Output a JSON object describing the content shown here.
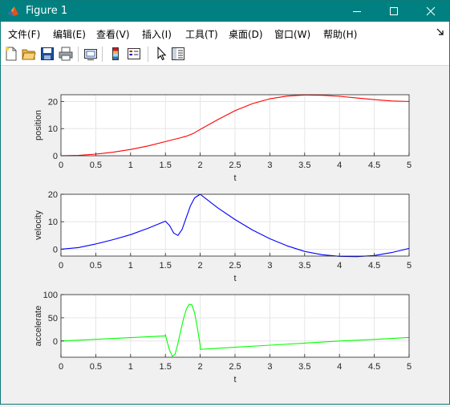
{
  "window": {
    "title": "Figure 1",
    "title_icon": "matlab-icon",
    "controls": [
      "minimize-icon",
      "maximize-icon",
      "close-icon"
    ]
  },
  "menu": {
    "items": [
      "文件(F)",
      "编辑(E)",
      "查看(V)",
      "插入(I)",
      "工具(T)",
      "桌面(D)",
      "窗口(W)",
      "帮助(H)"
    ],
    "dock_icon": "dock-arrow-icon"
  },
  "toolbar": {
    "buttons": [
      "new-figure-icon",
      "open-file-icon",
      "save-icon",
      "print-icon",
      "link-plot-icon",
      "insert-colorbar-icon",
      "insert-legend-icon",
      "edit-plot-icon",
      "open-property-inspector-icon"
    ]
  },
  "chart_data": [
    {
      "type": "line",
      "xlabel": "t",
      "ylabel": "position",
      "xlim": [
        0,
        5
      ],
      "ylim": [
        0,
        22.5
      ],
      "xticks": [
        "0",
        "0.5",
        "1",
        "1.5",
        "2",
        "2.5",
        "3",
        "3.5",
        "4",
        "4.5",
        "5"
      ],
      "yticks": [
        "0",
        "10",
        "20"
      ],
      "grid": true,
      "series": [
        {
          "color": "#ff0000",
          "x": [
            0,
            0.25,
            0.5,
            0.75,
            1,
            1.25,
            1.5,
            1.6,
            1.7,
            1.8,
            1.9,
            2,
            2.25,
            2.5,
            2.75,
            3,
            3.25,
            3.5,
            3.75,
            4,
            4.25,
            4.5,
            4.75,
            5
          ],
          "y": [
            0,
            0.15,
            0.6,
            1.3,
            2.3,
            3.6,
            5.2,
            5.9,
            6.5,
            7.2,
            8.2,
            9.7,
            13.3,
            16.6,
            19.2,
            21.0,
            22.0,
            22.4,
            22.3,
            21.9,
            21.3,
            20.7,
            20.2,
            20.0
          ]
        }
      ]
    },
    {
      "type": "line",
      "xlabel": "t",
      "ylabel": "velocity",
      "xlim": [
        0,
        5
      ],
      "ylim": [
        -2.5,
        20
      ],
      "xticks": [
        "0",
        "0.5",
        "1",
        "1.5",
        "2",
        "2.5",
        "3",
        "3.5",
        "4",
        "4.5",
        "5"
      ],
      "yticks": [
        "0",
        "10",
        "20"
      ],
      "grid": true,
      "series": [
        {
          "color": "#0000ff",
          "x": [
            0,
            0.25,
            0.5,
            0.75,
            1,
            1.25,
            1.5,
            1.56,
            1.62,
            1.68,
            1.74,
            1.8,
            1.86,
            1.92,
            2,
            2.25,
            2.5,
            2.75,
            3,
            3.25,
            3.5,
            3.75,
            4,
            4.25,
            4.5,
            4.75,
            5
          ],
          "y": [
            0,
            0.6,
            1.9,
            3.5,
            5.3,
            7.6,
            10.2,
            8.6,
            5.9,
            5.0,
            7.2,
            11.5,
            15.8,
            18.7,
            20,
            15.1,
            10.8,
            7.0,
            3.8,
            1.2,
            -0.8,
            -2.0,
            -2.6,
            -2.7,
            -2.3,
            -1.2,
            0.3
          ]
        }
      ]
    },
    {
      "type": "line",
      "xlabel": "t",
      "ylabel": "accelerate",
      "xlim": [
        0,
        5
      ],
      "ylim": [
        -35,
        100
      ],
      "xticks": [
        "0",
        "0.5",
        "1",
        "1.5",
        "2",
        "2.5",
        "3",
        "3.5",
        "4",
        "4.5",
        "5"
      ],
      "yticks": [
        "0",
        "50",
        "100"
      ],
      "grid": true,
      "series": [
        {
          "color": "#00ff00",
          "x": [
            0,
            0.5,
            1,
            1.5,
            1.5,
            1.53,
            1.56,
            1.6,
            1.64,
            1.68,
            1.72,
            1.76,
            1.8,
            1.84,
            1.88,
            1.92,
            1.96,
            2.0,
            2.0,
            2.5,
            3,
            3.5,
            4,
            4.5,
            5
          ],
          "y": [
            0,
            3.6,
            7.2,
            11,
            14,
            -4,
            -20,
            -33,
            -28,
            -5,
            22,
            48,
            68,
            79,
            78,
            60,
            28,
            -10,
            -18,
            -13.5,
            -9,
            -4.5,
            0,
            3.5,
            7.5
          ]
        }
      ]
    }
  ]
}
